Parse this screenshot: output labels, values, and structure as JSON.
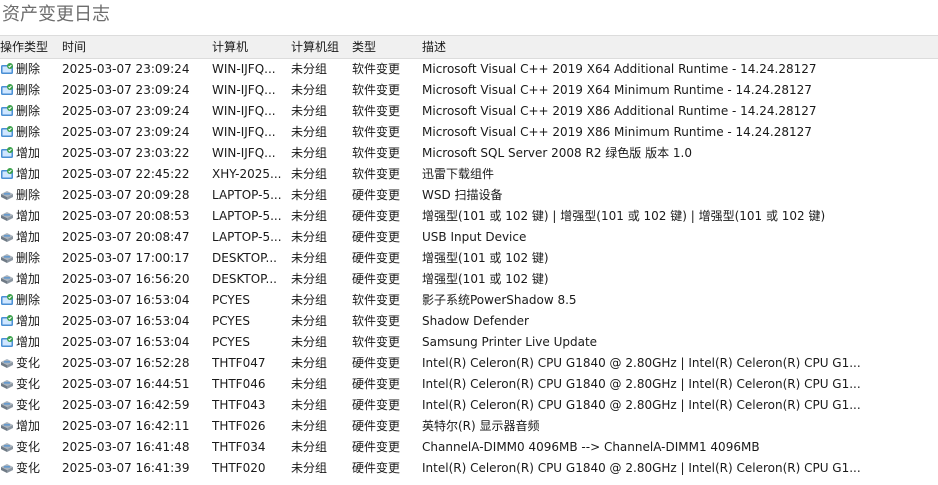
{
  "title": "资产变更日志",
  "columns": {
    "op": "操作类型",
    "time": "时间",
    "computer": "计算机",
    "group": "计算机组",
    "type": "类型",
    "desc": "描述"
  },
  "rows": [
    {
      "op": "删除",
      "time": "2025-03-07 23:09:24",
      "computer": "WIN-IJFQ...",
      "group": "未分组",
      "type": "软件变更",
      "desc": "Microsoft Visual C++ 2019 X64 Additional Runtime - 14.24.28127",
      "icon": "software-icon"
    },
    {
      "op": "删除",
      "time": "2025-03-07 23:09:24",
      "computer": "WIN-IJFQ...",
      "group": "未分组",
      "type": "软件变更",
      "desc": "Microsoft Visual C++ 2019 X64 Minimum Runtime - 14.24.28127",
      "icon": "software-icon"
    },
    {
      "op": "删除",
      "time": "2025-03-07 23:09:24",
      "computer": "WIN-IJFQ...",
      "group": "未分组",
      "type": "软件变更",
      "desc": "Microsoft Visual C++ 2019 X86 Additional Runtime - 14.24.28127",
      "icon": "software-icon"
    },
    {
      "op": "删除",
      "time": "2025-03-07 23:09:24",
      "computer": "WIN-IJFQ...",
      "group": "未分组",
      "type": "软件变更",
      "desc": "Microsoft Visual C++ 2019 X86 Minimum Runtime - 14.24.28127",
      "icon": "software-icon"
    },
    {
      "op": "增加",
      "time": "2025-03-07 23:03:22",
      "computer": "WIN-IJFQ...",
      "group": "未分组",
      "type": "软件变更",
      "desc": "Microsoft SQL Server 2008 R2 绿色版 版本 1.0",
      "icon": "software-icon"
    },
    {
      "op": "增加",
      "time": "2025-03-07 22:45:22",
      "computer": "XHY-2025...",
      "group": "未分组",
      "type": "软件变更",
      "desc": "迅雷下载组件",
      "icon": "software-icon"
    },
    {
      "op": "删除",
      "time": "2025-03-07 20:09:28",
      "computer": "LAPTOP-5...",
      "group": "未分组",
      "type": "硬件变更",
      "desc": "WSD 扫描设备",
      "icon": "hardware-icon"
    },
    {
      "op": "增加",
      "time": "2025-03-07 20:08:53",
      "computer": "LAPTOP-5...",
      "group": "未分组",
      "type": "硬件变更",
      "desc": "增强型(101 或 102 键) | 增强型(101 或 102 键) | 增强型(101 或 102 键)",
      "icon": "hardware-icon"
    },
    {
      "op": "增加",
      "time": "2025-03-07 20:08:47",
      "computer": "LAPTOP-5...",
      "group": "未分组",
      "type": "硬件变更",
      "desc": "USB Input Device",
      "icon": "hardware-icon"
    },
    {
      "op": "删除",
      "time": "2025-03-07 17:00:17",
      "computer": "DESKTOP...",
      "group": "未分组",
      "type": "硬件变更",
      "desc": "增强型(101 或 102 键)",
      "icon": "hardware-icon"
    },
    {
      "op": "增加",
      "time": "2025-03-07 16:56:20",
      "computer": "DESKTOP...",
      "group": "未分组",
      "type": "硬件变更",
      "desc": "增强型(101 或 102 键)",
      "icon": "hardware-icon"
    },
    {
      "op": "删除",
      "time": "2025-03-07 16:53:04",
      "computer": "PCYES",
      "group": "未分组",
      "type": "软件变更",
      "desc": "影子系统PowerShadow 8.5",
      "icon": "software-icon"
    },
    {
      "op": "增加",
      "time": "2025-03-07 16:53:04",
      "computer": "PCYES",
      "group": "未分组",
      "type": "软件变更",
      "desc": "Shadow Defender",
      "icon": "software-icon"
    },
    {
      "op": "增加",
      "time": "2025-03-07 16:53:04",
      "computer": "PCYES",
      "group": "未分组",
      "type": "软件变更",
      "desc": "Samsung Printer Live Update",
      "icon": "software-icon"
    },
    {
      "op": "变化",
      "time": "2025-03-07 16:52:28",
      "computer": "THTF047",
      "group": "未分组",
      "type": "硬件变更",
      "desc": "Intel(R) Celeron(R) CPU G1840 @ 2.80GHz | Intel(R) Celeron(R) CPU G1...",
      "icon": "hardware-icon"
    },
    {
      "op": "变化",
      "time": "2025-03-07 16:44:51",
      "computer": "THTF046",
      "group": "未分组",
      "type": "硬件变更",
      "desc": "Intel(R) Celeron(R) CPU G1840 @ 2.80GHz | Intel(R) Celeron(R) CPU G1...",
      "icon": "hardware-icon"
    },
    {
      "op": "变化",
      "time": "2025-03-07 16:42:59",
      "computer": "THTF043",
      "group": "未分组",
      "type": "硬件变更",
      "desc": "Intel(R) Celeron(R) CPU G1840 @ 2.80GHz | Intel(R) Celeron(R) CPU G1...",
      "icon": "hardware-icon"
    },
    {
      "op": "增加",
      "time": "2025-03-07 16:42:11",
      "computer": "THTF026",
      "group": "未分组",
      "type": "硬件变更",
      "desc": "英特尔(R) 显示器音频",
      "icon": "hardware-icon"
    },
    {
      "op": "变化",
      "time": "2025-03-07 16:41:48",
      "computer": "THTF034",
      "group": "未分组",
      "type": "硬件变更",
      "desc": "ChannelA-DIMM0 4096MB  -->  ChannelA-DIMM1 4096MB",
      "icon": "hardware-icon"
    },
    {
      "op": "变化",
      "time": "2025-03-07 16:41:39",
      "computer": "THTF020",
      "group": "未分组",
      "type": "硬件变更",
      "desc": "Intel(R) Celeron(R) CPU G1840 @ 2.80GHz | Intel(R) Celeron(R) CPU G1...",
      "icon": "hardware-icon"
    }
  ]
}
